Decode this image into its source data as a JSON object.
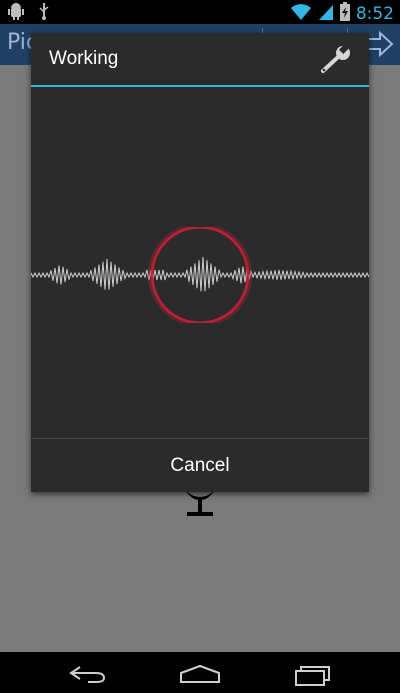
{
  "status_bar": {
    "time": "8:52",
    "icons": [
      "android-debug-icon",
      "usb-icon",
      "wifi-icon",
      "signal-icon",
      "battery-charging-icon"
    ]
  },
  "app_bar": {
    "title_partial": "Pic",
    "icons": [
      "forward-arrow-icon"
    ]
  },
  "dialog": {
    "title": "Working",
    "settings_icon": "wrench-icon",
    "cancel_label": "Cancel",
    "accent": "#33b5e5",
    "record_ring_color": "#c21f35"
  },
  "nav_bar": {
    "icons": [
      "back-icon",
      "home-icon",
      "recent-apps-icon"
    ]
  }
}
